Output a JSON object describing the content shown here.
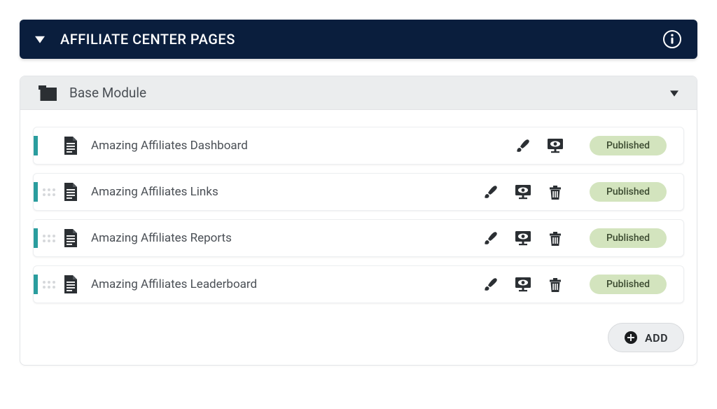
{
  "header": {
    "title": "AFFILIATE CENTER PAGES"
  },
  "module": {
    "title": "Base Module"
  },
  "pages": [
    {
      "title": "Amazing Affiliates Dashboard",
      "status": "Published",
      "draggable": false,
      "deletable": false
    },
    {
      "title": "Amazing Affiliates Links",
      "status": "Published",
      "draggable": true,
      "deletable": true
    },
    {
      "title": "Amazing Affiliates Reports",
      "status": "Published",
      "draggable": true,
      "deletable": true
    },
    {
      "title": "Amazing Affiliates Leaderboard",
      "status": "Published",
      "draggable": true,
      "deletable": true
    }
  ],
  "add_button": {
    "label": "ADD"
  },
  "colors": {
    "header_bg": "#0a1e3d",
    "accent": "#2a9d9e",
    "badge_bg": "#d3e4be"
  }
}
